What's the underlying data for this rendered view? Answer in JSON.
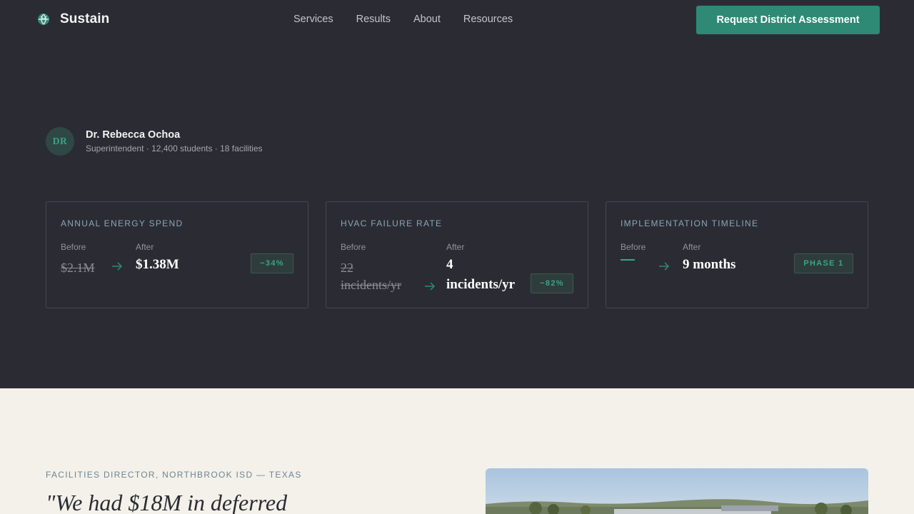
{
  "nav": {
    "brand": "Sustain",
    "links": [
      "Services",
      "Results",
      "About",
      "Resources"
    ],
    "cta": "Request District Assessment"
  },
  "person": {
    "initials": "DR",
    "name": "Dr. Rebecca Ochoa",
    "meta": "Superintendent · 12,400 students · 18 facilities"
  },
  "metrics": [
    {
      "title": "ANNUAL ENERGY SPEND",
      "before_label": "Before",
      "before": "$2.1M",
      "after_label": "After",
      "after": "$1.38M",
      "badge": "−34%"
    },
    {
      "title": "HVAC FAILURE RATE",
      "before_label": "Before",
      "before_1": "22",
      "before_2": "incidents/yr",
      "after_label": "After",
      "after_1": "4",
      "after_2": "incidents/yr",
      "badge": "−82%"
    },
    {
      "title": "IMPLEMENTATION TIMELINE",
      "before_label": "Before",
      "after_label": "After",
      "after": "9 months",
      "badge": "PHASE 1"
    }
  ],
  "testimonial": {
    "eyebrow": "FACILITIES DIRECTOR, NORTHBROOK ISD — TEXAS",
    "quote": "\"We had $18M in deferred"
  },
  "colors": {
    "accent": "#2e8a74",
    "dark_bg": "#2b2c33",
    "light_bg": "#f3f1ea"
  }
}
